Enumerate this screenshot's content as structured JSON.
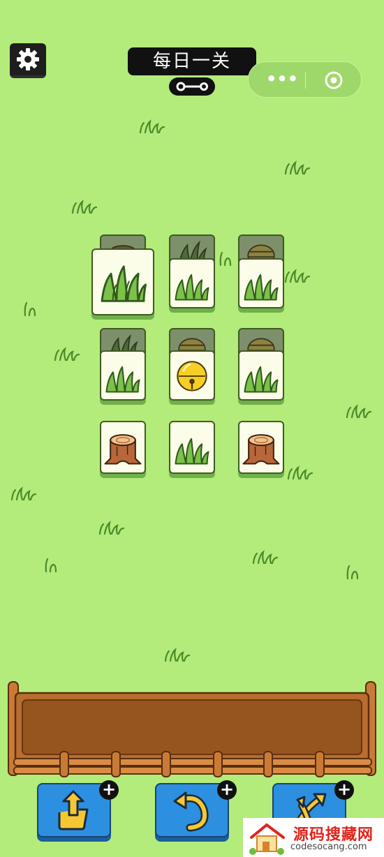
{
  "header": {
    "title": "每日一关"
  },
  "miniprogram_capsule": {
    "more_label": "•••"
  },
  "tiles": [
    {
      "row": 0,
      "col": 0,
      "icon": "grass",
      "state": "selected"
    },
    {
      "row": 0,
      "col": 1,
      "icon": "grass",
      "state": "top"
    },
    {
      "row": 0,
      "col": 2,
      "icon": "grass",
      "state": "top"
    },
    {
      "row": 1,
      "col": 0,
      "icon": "grass",
      "state": "top"
    },
    {
      "row": 1,
      "col": 1,
      "icon": "bell",
      "state": "top"
    },
    {
      "row": 1,
      "col": 2,
      "icon": "grass",
      "state": "top"
    },
    {
      "row": 2,
      "col": 0,
      "icon": "stump",
      "state": "top"
    },
    {
      "row": 2,
      "col": 1,
      "icon": "grass",
      "state": "top"
    },
    {
      "row": 2,
      "col": 2,
      "icon": "stump",
      "state": "top"
    }
  ],
  "covered_tiles": [
    {
      "icon": "stump"
    },
    {
      "icon": "grass"
    },
    {
      "icon": "beehive"
    },
    {
      "icon": "grass"
    },
    {
      "icon": "beehive"
    },
    {
      "icon": "beehive"
    }
  ],
  "tray": {
    "slots_filled": 0
  },
  "powerups": [
    {
      "name": "move-out",
      "icon": "move-out-icon",
      "add_symbol": "+"
    },
    {
      "name": "undo",
      "icon": "undo-icon",
      "add_symbol": "+"
    },
    {
      "name": "shuffle",
      "icon": "shuffle-icon",
      "add_symbol": "+"
    }
  ],
  "watermark": {
    "title": "源码搜藏网",
    "url": "codesocang.com"
  },
  "colors": {
    "background": "#b3ec7a",
    "tile_face": "#fbfde9",
    "button_blue": "#2c8fe0",
    "fence_brown": "#a8662a"
  }
}
